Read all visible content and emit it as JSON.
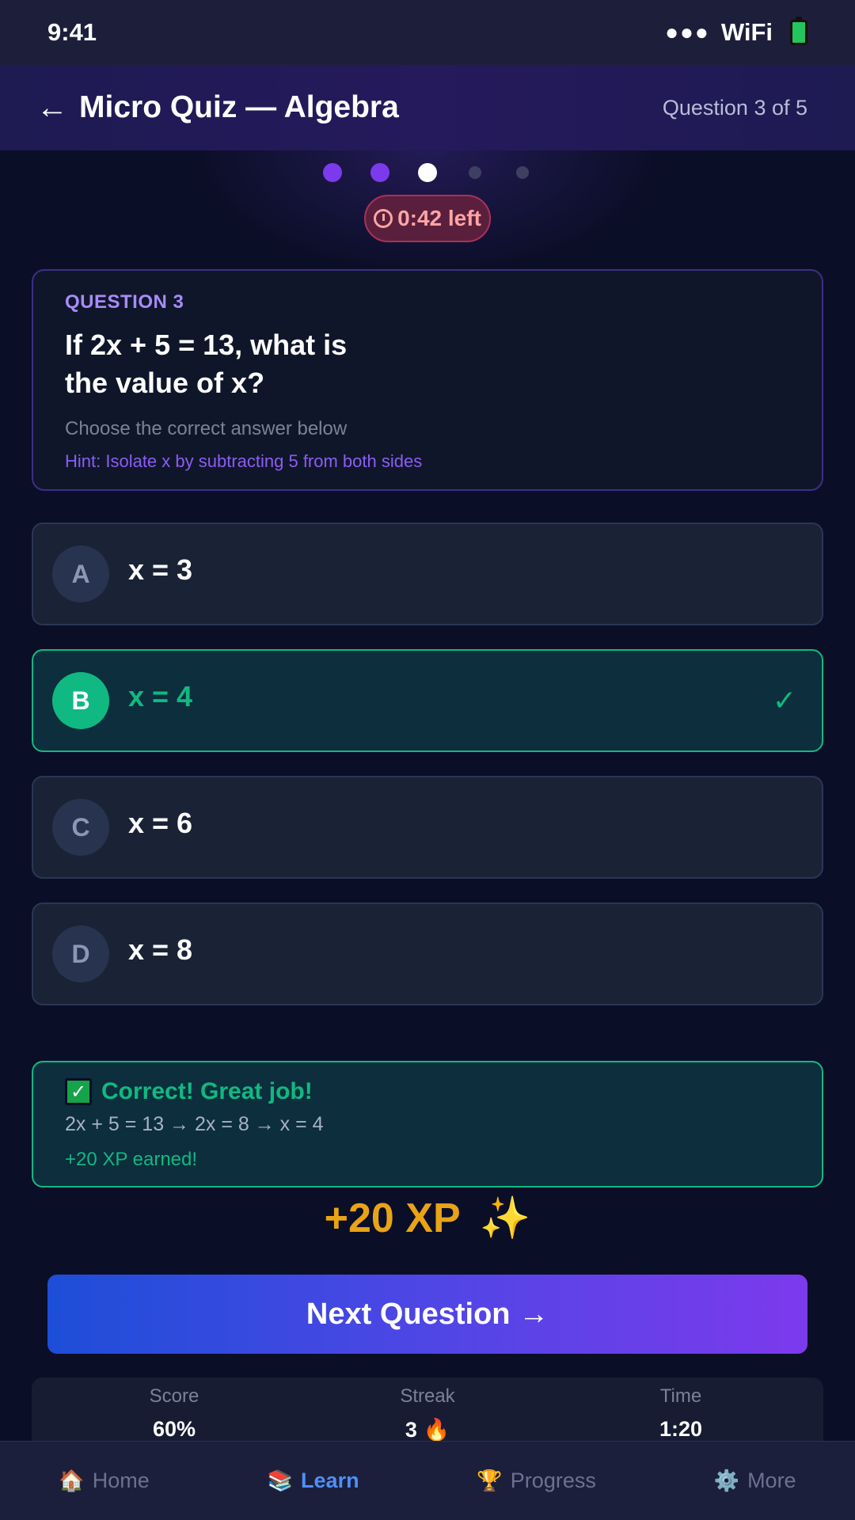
{
  "status_bar": {
    "time": "9:41",
    "signal": "●●●",
    "wifi": "WiFi"
  },
  "header": {
    "back": "←",
    "title": "Micro Quiz — Algebra",
    "progress": "Question 3 of 5"
  },
  "progress_dots": {
    "total": 5,
    "current": 3
  },
  "timer": {
    "label": "0:42 left"
  },
  "question": {
    "label": "QUESTION 3",
    "text": "If 2x + 5 = 13, what is the value of x?",
    "instruction": "Choose the correct answer below",
    "hint": "Hint: Isolate x by subtracting 5 from both sides"
  },
  "options": [
    {
      "letter": "A",
      "text": "x = 3"
    },
    {
      "letter": "B",
      "text": "x = 4",
      "check": "✓"
    },
    {
      "letter": "C",
      "text": "x = 6"
    },
    {
      "letter": "D",
      "text": "x = 8"
    }
  ],
  "feedback": {
    "title": "Correct! Great job!",
    "steps": "2x + 5 = 13 → 2x = 8 → x = 4",
    "xp": "+20 XP earned!"
  },
  "xp_award": {
    "text": "+20 XP",
    "icon": "✨"
  },
  "next_button": {
    "label": "Next Question →"
  },
  "stats": [
    {
      "label": "Score",
      "value": "60%"
    },
    {
      "label": "Streak",
      "value": "3 🔥"
    },
    {
      "label": "Time",
      "value": "1:20"
    }
  ],
  "nav": [
    {
      "icon": "🏠",
      "label": "Home"
    },
    {
      "icon": "📚",
      "label": "Learn"
    },
    {
      "icon": "🏆",
      "label": "Progress"
    },
    {
      "icon": "⚙️",
      "label": "More"
    }
  ],
  "colors": {
    "accent": "#7c3aed",
    "correct": "#10b981",
    "xp": "#e8a317",
    "nav_active": "#4f8ff7"
  }
}
